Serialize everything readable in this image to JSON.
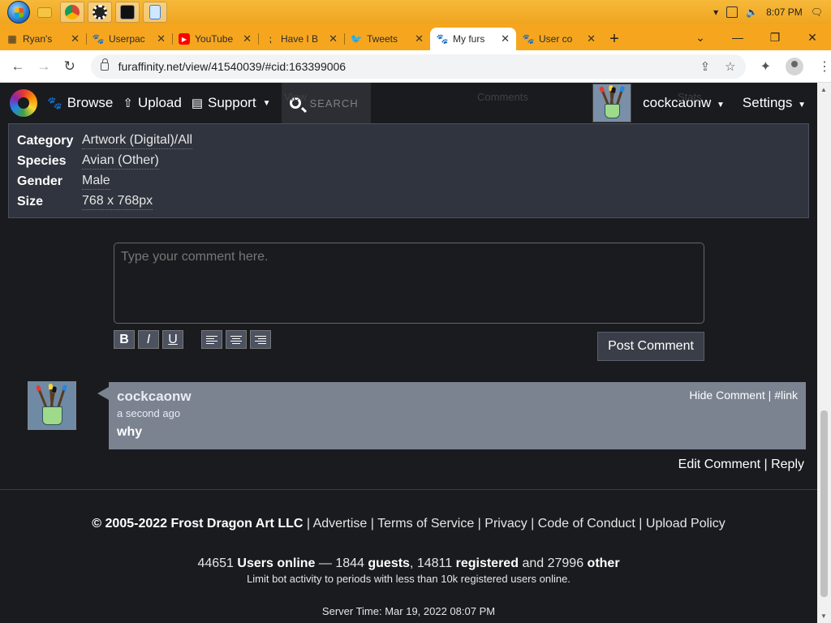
{
  "taskbar": {
    "clock": "8:07 PM",
    "apps": [
      "file-explorer",
      "chrome",
      "settings-app",
      "terminal",
      "notepad"
    ]
  },
  "tabs": [
    {
      "title": "Ryan's",
      "favicon": "site-icon"
    },
    {
      "title": "Userpac",
      "favicon": "paw-icon"
    },
    {
      "title": "YouTube",
      "favicon": "youtube-icon"
    },
    {
      "title": "Have I B",
      "favicon": "dots-icon"
    },
    {
      "title": "Tweets",
      "favicon": "twitter-icon"
    },
    {
      "title": "My furs",
      "favicon": "paw-icon",
      "active": true
    },
    {
      "title": "User co",
      "favicon": "paw-icon"
    }
  ],
  "address": {
    "url": "furaffinity.net/view/41540039/#cid:163399006"
  },
  "site_nav": {
    "browse": "Browse",
    "upload": "Upload",
    "support": "Support",
    "search_placeholder": "SEARCH",
    "ghost_view": "View",
    "ghost_comments": "Comments",
    "ghost_stats": "Stats",
    "username": "cockcaonw",
    "settings": "Settings"
  },
  "info": [
    {
      "label": "Category",
      "value": "Artwork (Digital)/All"
    },
    {
      "label": "Species",
      "value": "Avian (Other)"
    },
    {
      "label": "Gender",
      "value": "Male"
    },
    {
      "label": "Size",
      "value": "768 x 768px"
    }
  ],
  "comment_form": {
    "placeholder": "Type your comment here.",
    "bold": "B",
    "italic": "I",
    "underline": "U",
    "post": "Post Comment"
  },
  "comment": {
    "user": "cockcaonw",
    "time": "a second ago",
    "body": "why",
    "hide": "Hide Comment",
    "sep": " | ",
    "link": "#link",
    "edit": "Edit Comment",
    "reply": "Reply"
  },
  "footer": {
    "copyright": "© 2005-2022 Frost Dragon Art LLC",
    "links": [
      "Advertise",
      "Terms of Service",
      "Privacy",
      "Code of Conduct",
      "Upload Policy"
    ],
    "online_count": "44651",
    "online_label": "Users online",
    "dash": " — ",
    "guests_count": "1844",
    "guests_label": "guests",
    "registered_count": "14811",
    "registered_label": "registered",
    "and": "and",
    "other_count": "27996",
    "other_label": "other",
    "note": "Limit bot activity to periods with less than 10k registered users online.",
    "server_time": "Server Time: Mar 19, 2022 08:07 PM"
  },
  "colors": {
    "taskbar": "#f0a51f",
    "page_bg": "#1a1b1f",
    "info_bg": "#2f343e",
    "comment_bg": "#7b8290"
  }
}
